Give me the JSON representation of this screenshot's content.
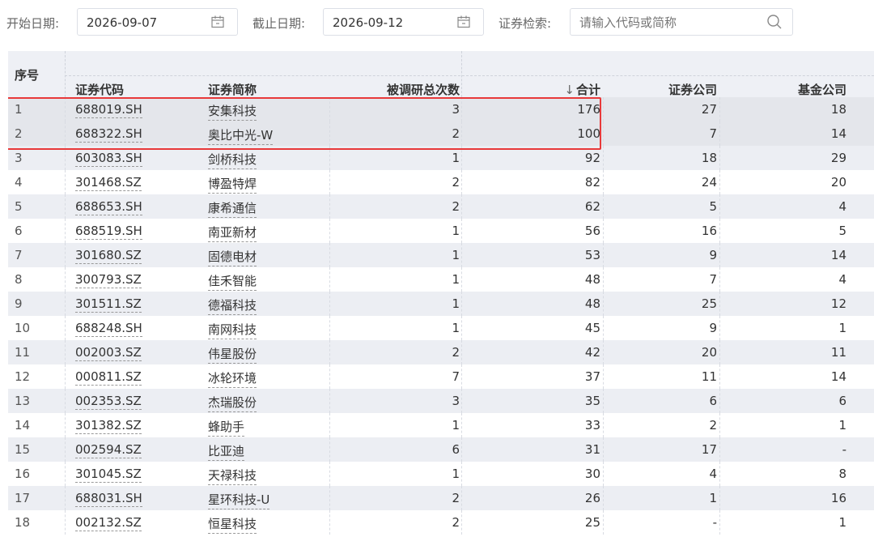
{
  "filters": {
    "start_date_label": "开始日期:",
    "start_date_value": "2026-09-07",
    "end_date_label": "截止日期:",
    "end_date_value": "2026-09-12",
    "search_label": "证券检索:",
    "search_placeholder": "请输入代码或简称"
  },
  "icons": {
    "start_date": "calendar-icon",
    "end_date": "calendar-icon",
    "search": "search-icon",
    "sort": "sort-down-arrow"
  },
  "table": {
    "headers": {
      "seq": "序号",
      "code": "证券代码",
      "name": "证券简称",
      "visits": "被调研总次数",
      "sort_arrow": "↓",
      "total": "合计",
      "broker": "证券公司",
      "fund": "基金公司"
    },
    "rows": [
      {
        "seq": "1",
        "code": "688019.SH",
        "name": "安集科技",
        "visits": "3",
        "total": "176",
        "broker": "27",
        "fund": "18"
      },
      {
        "seq": "2",
        "code": "688322.SH",
        "name": "奥比中光-W",
        "visits": "2",
        "total": "100",
        "broker": "7",
        "fund": "14"
      },
      {
        "seq": "3",
        "code": "603083.SH",
        "name": "剑桥科技",
        "visits": "1",
        "total": "92",
        "broker": "18",
        "fund": "29"
      },
      {
        "seq": "4",
        "code": "301468.SZ",
        "name": "博盈特焊",
        "visits": "2",
        "total": "82",
        "broker": "24",
        "fund": "20"
      },
      {
        "seq": "5",
        "code": "688653.SH",
        "name": "康希通信",
        "visits": "2",
        "total": "62",
        "broker": "5",
        "fund": "4"
      },
      {
        "seq": "6",
        "code": "688519.SH",
        "name": "南亚新材",
        "visits": "1",
        "total": "56",
        "broker": "16",
        "fund": "5"
      },
      {
        "seq": "7",
        "code": "301680.SZ",
        "name": "固德电材",
        "visits": "1",
        "total": "53",
        "broker": "9",
        "fund": "14"
      },
      {
        "seq": "8",
        "code": "300793.SZ",
        "name": "佳禾智能",
        "visits": "1",
        "total": "48",
        "broker": "7",
        "fund": "4"
      },
      {
        "seq": "9",
        "code": "301511.SZ",
        "name": "德福科技",
        "visits": "1",
        "total": "48",
        "broker": "25",
        "fund": "12"
      },
      {
        "seq": "10",
        "code": "688248.SH",
        "name": "南网科技",
        "visits": "1",
        "total": "45",
        "broker": "9",
        "fund": "1"
      },
      {
        "seq": "11",
        "code": "002003.SZ",
        "name": "伟星股份",
        "visits": "2",
        "total": "42",
        "broker": "20",
        "fund": "11"
      },
      {
        "seq": "12",
        "code": "000811.SZ",
        "name": "冰轮环境",
        "visits": "7",
        "total": "37",
        "broker": "11",
        "fund": "14"
      },
      {
        "seq": "13",
        "code": "002353.SZ",
        "name": "杰瑞股份",
        "visits": "3",
        "total": "35",
        "broker": "6",
        "fund": "6"
      },
      {
        "seq": "14",
        "code": "301382.SZ",
        "name": "蜂助手",
        "visits": "1",
        "total": "33",
        "broker": "2",
        "fund": "1"
      },
      {
        "seq": "15",
        "code": "002594.SZ",
        "name": "比亚迪",
        "visits": "6",
        "total": "31",
        "broker": "17",
        "fund": "-"
      },
      {
        "seq": "16",
        "code": "301045.SZ",
        "name": "天禄科技",
        "visits": "1",
        "total": "30",
        "broker": "4",
        "fund": "8"
      },
      {
        "seq": "17",
        "code": "688031.SH",
        "name": "星环科技-U",
        "visits": "2",
        "total": "26",
        "broker": "1",
        "fund": "16"
      },
      {
        "seq": "18",
        "code": "002132.SZ",
        "name": "恒星科技",
        "visits": "2",
        "total": "25",
        "broker": "-",
        "fund": "1"
      }
    ],
    "highlighted_rows": [
      1,
      2
    ]
  },
  "colors": {
    "highlight_border": "#e8393a",
    "header_bg": "#eef0f5",
    "stripe_bg": "#eceef3"
  }
}
